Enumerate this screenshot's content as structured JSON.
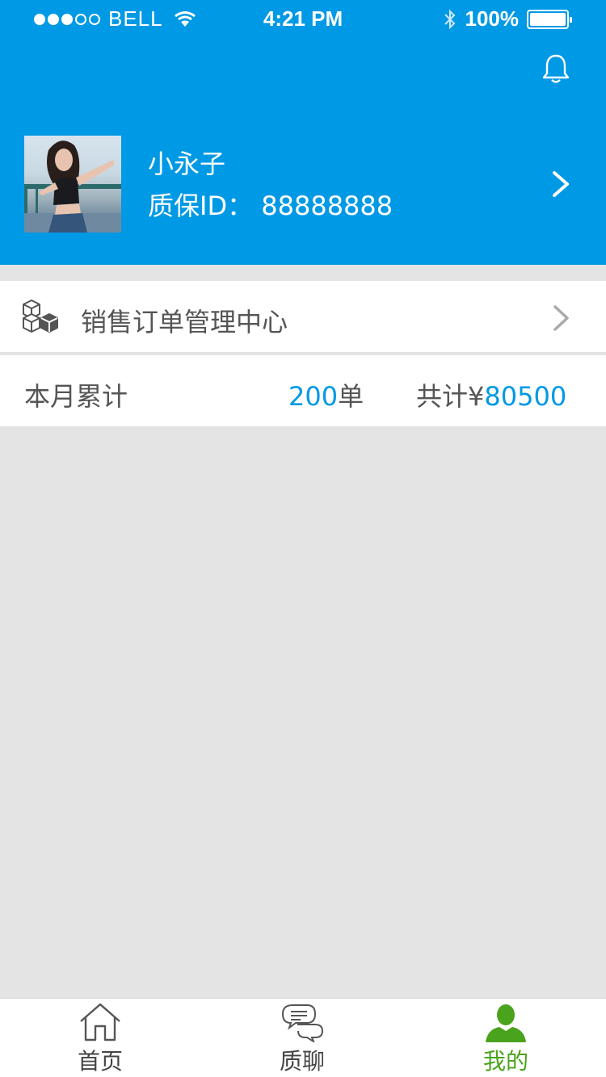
{
  "status_bar": {
    "carrier": "BELL",
    "time": "4:21 PM",
    "battery": "100%"
  },
  "profile": {
    "name": "小永子",
    "id_text": "质保ID： 88888888"
  },
  "order_center": {
    "label": "销售订单管理中心"
  },
  "summary": {
    "month_label": "本月累计",
    "orders_value": "200",
    "orders_unit": "单",
    "total_prefix": "共计¥",
    "total_value": "80500"
  },
  "tabbar": {
    "tabs": [
      {
        "label": "首页",
        "icon": "home-icon",
        "active": false
      },
      {
        "label": "质聊",
        "icon": "chat-icon",
        "active": false
      },
      {
        "label": "我的",
        "icon": "user-icon",
        "active": true
      }
    ]
  },
  "colors": {
    "brand_blue": "#0099e5",
    "active_green": "#4aa31c",
    "background_gray": "#e4e4e4"
  }
}
